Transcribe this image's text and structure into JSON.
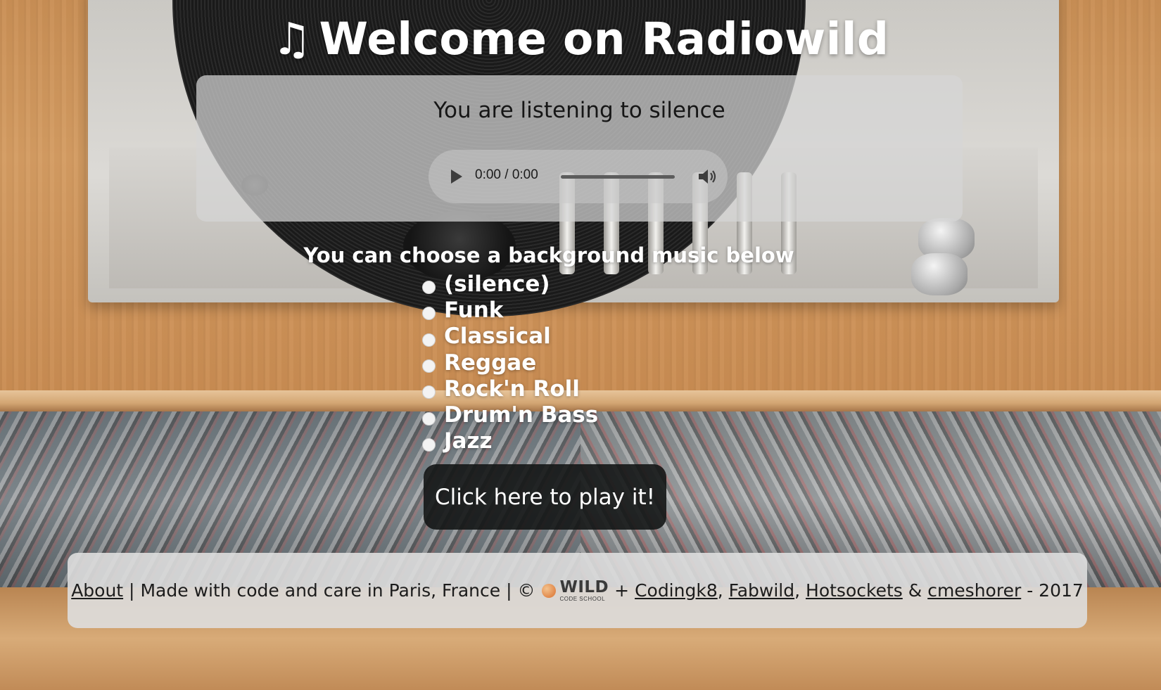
{
  "header": {
    "note_glyph": "♫",
    "title": "Welcome on Radiowild"
  },
  "player": {
    "now_playing": "You are listening to silence",
    "time": "0:00 / 0:00"
  },
  "selector": {
    "heading": "You can choose a background music below",
    "options": [
      "(silence)",
      "Funk",
      "Classical",
      "Reggae",
      "Rock'n Roll",
      "Drum'n Bass",
      "Jazz"
    ]
  },
  "play_button": {
    "label": "Click here to play it!"
  },
  "footer": {
    "about": "About",
    "made_with": "Made with code and care in Paris, France",
    "copyright": "©",
    "logo_main": "WILD",
    "logo_sub": "CODE SCHOOL",
    "plus": "+",
    "authors": [
      "Codingk8",
      "Fabwild",
      "Hotsockets",
      "cmeshorer"
    ],
    "amp": "&",
    "year": "- 2017"
  }
}
